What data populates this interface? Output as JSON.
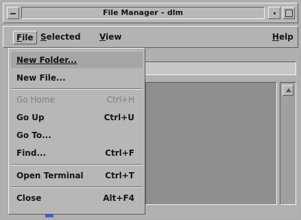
{
  "window": {
    "title": "File Manager – dlm"
  },
  "menubar": {
    "items": [
      {
        "label": "File",
        "mnemonic": "F",
        "rest": "ile"
      },
      {
        "label": "Selected",
        "mnemonic": "S",
        "rest": "elected"
      },
      {
        "label": "View",
        "mnemonic": "V",
        "rest": "iew"
      },
      {
        "label": "Help",
        "mnemonic": "H",
        "rest": "elp"
      }
    ]
  },
  "file_menu": {
    "items": [
      {
        "label": "New Folder...",
        "shortcut": "",
        "enabled": true,
        "highlighted": true
      },
      {
        "label": "New File...",
        "shortcut": "",
        "enabled": true
      },
      {
        "label": "Go Home",
        "shortcut": "Ctrl+H",
        "enabled": false
      },
      {
        "label": "Go Up",
        "shortcut": "Ctrl+U",
        "enabled": true
      },
      {
        "label": "Go To...",
        "shortcut": "",
        "enabled": true
      },
      {
        "label": "Find...",
        "shortcut": "Ctrl+F",
        "enabled": true
      },
      {
        "label": "Open Terminal",
        "shortcut": "Ctrl+T",
        "enabled": true
      },
      {
        "label": "Close",
        "shortcut": "Alt+F4",
        "enabled": true
      }
    ]
  },
  "icons": {
    "window_menu": "window-menu-icon",
    "minimize": "minimize-icon",
    "maximize": "maximize-icon",
    "scroll_up": "scroll-up-arrow-icon",
    "folder": "folder-icon"
  },
  "colors": {
    "background": "#aeaeae",
    "menu_highlight": "#a6a6a6",
    "disabled_text": "#7d7d7d",
    "folder_icon": "#3d5bd1"
  }
}
